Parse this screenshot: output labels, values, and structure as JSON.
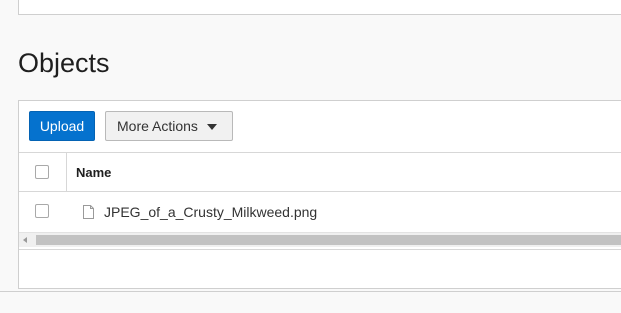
{
  "section": {
    "title": "Objects"
  },
  "toolbar": {
    "upload_label": "Upload",
    "more_actions_label": "More Actions"
  },
  "table": {
    "columns": [
      "Name"
    ],
    "rows": [
      {
        "name": "JPEG_of_a_Crusty_Milkweed.png",
        "icon": "file-icon"
      }
    ]
  },
  "colors": {
    "primary": "#0572ce",
    "border": "#cfcfcf",
    "background": "#f9f9f9"
  }
}
